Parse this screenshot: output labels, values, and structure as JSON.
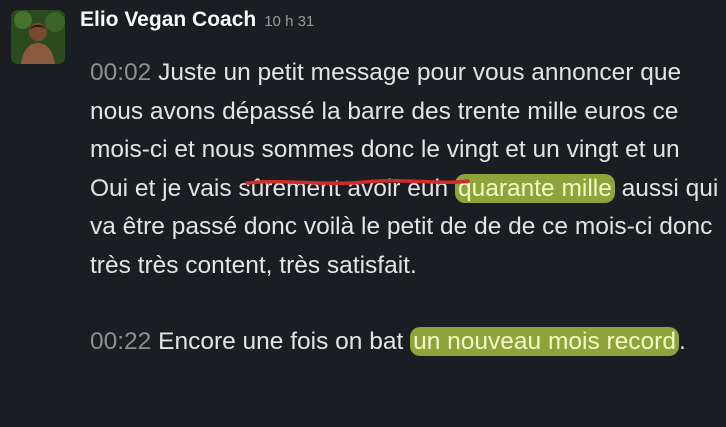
{
  "message": {
    "sender": "Elio Vegan Coach",
    "time": "10 h 31",
    "avatar_icon": "person-avatar",
    "highlight_color": "#8ea43a",
    "underline_color": "#d42a2a",
    "paragraphs": [
      {
        "timestamp": "00:02",
        "text_before": " Juste un petit message pour vous annoncer que nous avons dépassé la barre des trente mille euros ce mois-ci et nous sommes donc le vingt et un vingt et un Oui et je vais sûrement avoir euh ",
        "highlight": "quarante mille",
        "text_after": " aussi qui va être passé donc voilà le petit de de de ce mois-ci donc très très content, très satisfait."
      },
      {
        "timestamp": "00:22",
        "text_before": " Encore une fois on bat ",
        "highlight": "un nouveau mois record",
        "text_after": "."
      }
    ]
  }
}
